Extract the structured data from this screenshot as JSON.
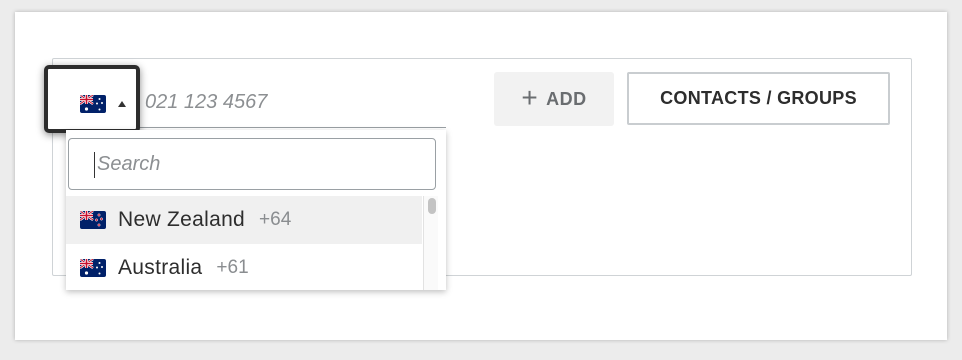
{
  "phone": {
    "selected_country_flag": "australia-flag",
    "placeholder": "021 123 4567"
  },
  "actions": {
    "add_label": "ADD",
    "contacts_label": "CONTACTS / GROUPS"
  },
  "country_dropdown": {
    "search_placeholder": "Search",
    "countries": [
      {
        "name": "New Zealand",
        "code": "+64",
        "flag": "new-zealand-flag",
        "highlighted": true
      },
      {
        "name": "Australia",
        "code": "+61",
        "flag": "australia-flag",
        "highlighted": false
      }
    ]
  },
  "colors": {
    "focus_border": "#2d2d2d",
    "flag_blue": "#012169",
    "flag_red": "#c8102e"
  }
}
